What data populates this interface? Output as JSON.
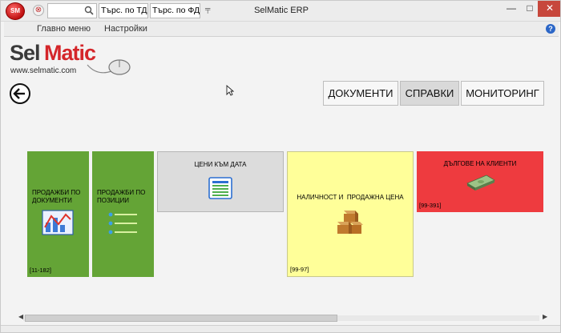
{
  "titlebar": {
    "app_logo_text": "SM",
    "search_value": "",
    "search_td_label": "Търс. по ТД",
    "search_fd_label": "Търс. по ФД",
    "dropdown_glyph": "╤",
    "title": "SelMatic ERP",
    "minimize_glyph": "—",
    "maximize_glyph": "□",
    "close_glyph": "✕"
  },
  "menubar": {
    "items": [
      "Главно меню",
      "Настройки"
    ],
    "help_glyph": "?"
  },
  "brand": {
    "sel": "Sel",
    "matic": "Matic",
    "url": "www.selmatic.com"
  },
  "tabs": [
    {
      "label": "ДОКУМЕНТИ",
      "active": false
    },
    {
      "label": "СПРАВКИ",
      "active": true
    },
    {
      "label": "МОНИТОРИНГ",
      "active": false
    }
  ],
  "tiles": [
    {
      "label": "ПРОДАЖБИ ПО ДОКУМЕНТИ",
      "code": "[11-182]",
      "color": "#64a436",
      "icon": "chart-icon"
    },
    {
      "label": "ПРОДАЖБИ ПО ПОЗИЦИИ",
      "code": "",
      "color": "#64a436",
      "icon": "list-icon"
    },
    {
      "label": "ЦЕНИ КЪМ ДАТА",
      "code": "",
      "color": "#dcdcdc",
      "icon": "document-icon"
    },
    {
      "label": "НАЛИЧНОСТ и  ПРОДАЖНА ЦЕНА",
      "code": "[99-97]",
      "color": "#ffff99",
      "icon": "boxes-icon"
    },
    {
      "label": "ДЪЛГОВЕ НА КЛИЕНТИ",
      "code": "[99-391]",
      "color": "#ee3b3f",
      "icon": "money-icon"
    }
  ],
  "colors": {
    "brand_red": "#d4262a",
    "tile_green": "#64a436",
    "tile_gray": "#dcdcdc",
    "tile_yellow": "#ffff99",
    "tile_red": "#ee3b3f"
  }
}
